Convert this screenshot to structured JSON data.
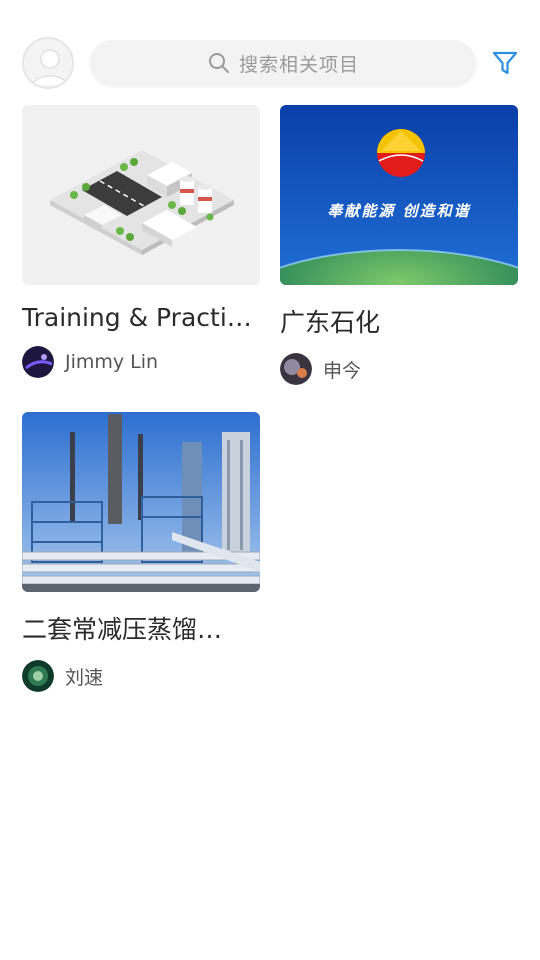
{
  "header": {
    "search_placeholder": "搜索相关项目",
    "icons": {
      "avatar": "user-avatar-icon",
      "search": "search-icon",
      "filter": "filter-funnel-icon"
    },
    "accent_color": "#2f8fe0"
  },
  "projects": [
    {
      "title": "Training  & Practi…",
      "author": "Jimmy Lin"
    },
    {
      "title": "广东石化",
      "author": "申今",
      "thumb_text": "奉献能源  创造和谐"
    },
    {
      "title": "二套常减压蒸馏…",
      "author": "刘速"
    }
  ]
}
